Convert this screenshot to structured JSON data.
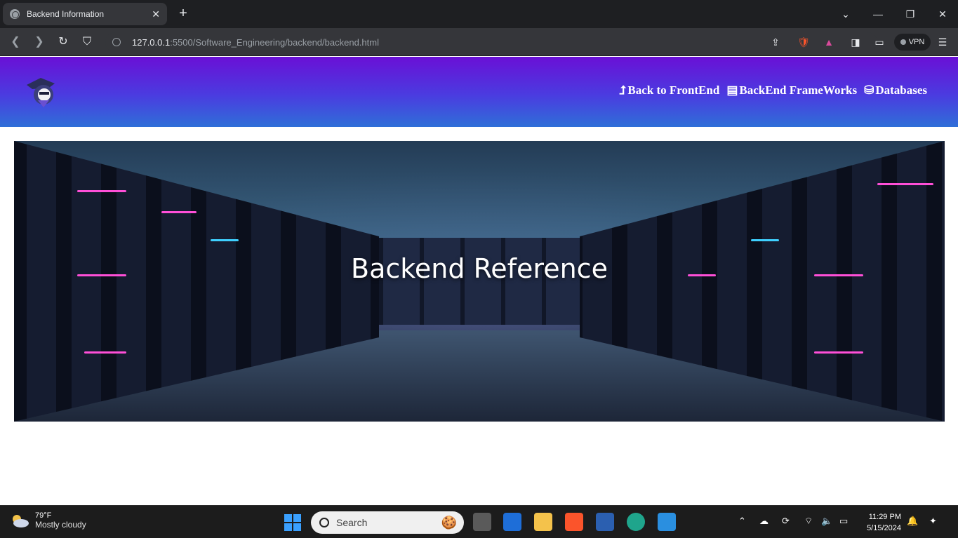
{
  "browser": {
    "tab_title": "Backend Information",
    "url_host": "127.0.0.1",
    "url_rest": ":5500/Software_Engineering/backend/backend.html",
    "vpn_label": "VPN"
  },
  "site": {
    "nav": [
      {
        "icon": "⮥",
        "label": "Back to FrontEnd"
      },
      {
        "icon": "▤",
        "label": "BackEnd FrameWorks"
      },
      {
        "icon": "⛁",
        "label": "Databases"
      }
    ],
    "hero_title": "Backend Reference"
  },
  "taskbar": {
    "weather_temp": "79°F",
    "weather_condition": "Mostly cloudy",
    "search_placeholder": "Search",
    "time": "11:29 PM",
    "date": "5/15/2024"
  }
}
